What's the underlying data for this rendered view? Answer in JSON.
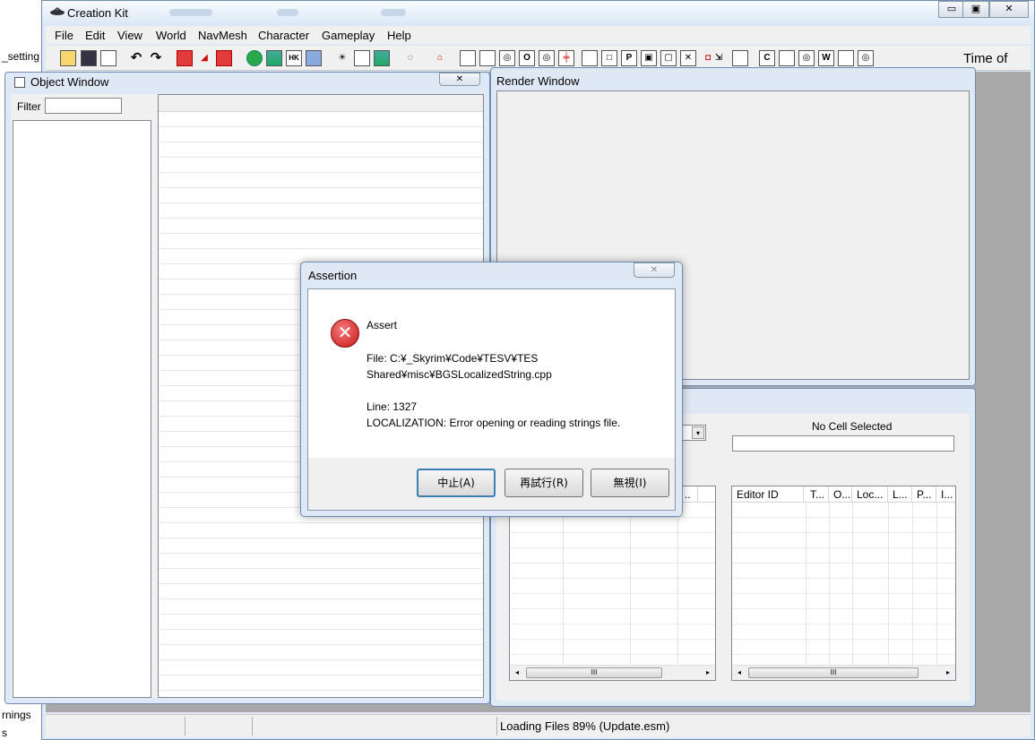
{
  "background_app": {
    "text_settings": "_setting",
    "text_warnings": "rnings",
    "text_s": "s"
  },
  "window": {
    "title": "Creation Kit",
    "minimize_glyph": "▭",
    "maximize_glyph": "▣",
    "close_glyph": "✕"
  },
  "menu": [
    "File",
    "Edit",
    "View",
    "World",
    "NavMesh",
    "Character",
    "Gameplay",
    "Help"
  ],
  "toolbar": {
    "time_of_label": "Time of",
    "letter_buttons": [
      "O",
      "P",
      "C",
      "W"
    ]
  },
  "object_window": {
    "title": "Object Window",
    "close_glyph": "✕",
    "filter_label": "Filter",
    "filter_value": ""
  },
  "render_window": {
    "title": "Render Window"
  },
  "cell_window": {
    "no_cell_label": "No Cell Selected",
    "left_columns": [
      ".."
    ],
    "right_columns": [
      "Editor ID",
      "T...",
      "O...",
      "Loc...",
      "L...",
      "P...",
      "I..."
    ],
    "scroll_thumb_glyph": "III",
    "scroll_left_glyph": "◂",
    "scroll_right_glyph": "▸",
    "dropdown_glyph": "▾"
  },
  "status": {
    "loading_text": "Loading Files 89% (Update.esm)"
  },
  "assertion_dialog": {
    "title": "Assertion",
    "close_glyph": "✕",
    "icon_glyph": "✕",
    "heading": "Assert",
    "file_line1": "File: C:¥_Skyrim¥Code¥TESV¥TES",
    "file_line2": "Shared¥misc¥BGSLocalizedString.cpp",
    "line_text": "Line: 1327",
    "message": "LOCALIZATION: Error opening or reading strings file.",
    "buttons": {
      "abort": "中止(A)",
      "retry": "再試行(R)",
      "ignore": "無視(I)"
    }
  }
}
